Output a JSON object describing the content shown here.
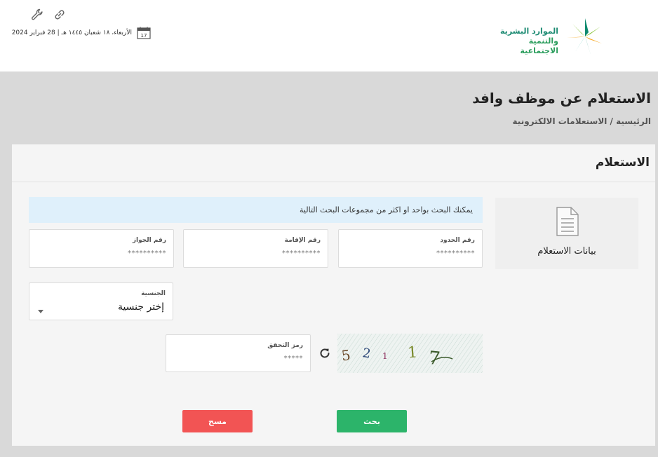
{
  "header": {
    "logo_line1": "الموارد البشرية",
    "logo_line2": "والتنمية الاجتماعية",
    "date": "الأربعاء، ١٨ شعبان ١٤٤٥ هـ | 28 فبراير 2024",
    "calendar_day": "17"
  },
  "page": {
    "title": "الاستعلام عن موظف وافد",
    "breadcrumb": "الرئيسية / الاستعلامات الالكترونية"
  },
  "card": {
    "title": "الاستعلام",
    "side_label": "بيانات الاستعلام",
    "info": "يمكنك البحث بواحد او اكثر من مجموعات البحث التالية"
  },
  "fields": {
    "border_label": "رقم الحدود",
    "border_value": "**********",
    "iqama_label": "رقم الإقامة",
    "iqama_value": "**********",
    "passport_label": "رقم الجواز",
    "passport_value": "**********",
    "nationality_label": "الجنسية",
    "nationality_value": "إختر جنسية",
    "captcha_label": "رمز التحقق",
    "captcha_value": "*****"
  },
  "captcha": {
    "chars": [
      "5",
      "2",
      "1",
      "1",
      "7"
    ]
  },
  "buttons": {
    "search": "بحث",
    "clear": "مسح"
  }
}
